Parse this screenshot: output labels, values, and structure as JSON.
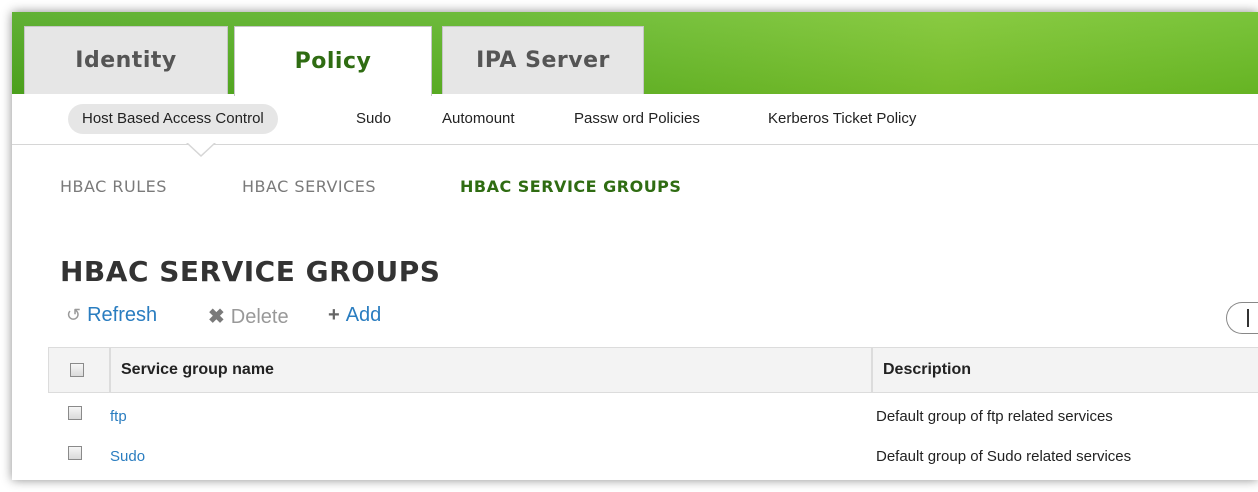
{
  "header": {
    "tabs": [
      {
        "label": "Identity"
      },
      {
        "label": "Policy"
      },
      {
        "label": "IPA Server"
      }
    ]
  },
  "subnav": {
    "items": [
      {
        "label": "Host Based Access Control"
      },
      {
        "label": "Sudo"
      },
      {
        "label": "Automount"
      },
      {
        "label": "Passw ord Policies"
      },
      {
        "label": "Kerberos Ticket Policy"
      }
    ]
  },
  "facets": [
    {
      "label": "HBAC RULES"
    },
    {
      "label": "HBAC SERVICES"
    },
    {
      "label": "HBAC SERVICE GROUPS"
    }
  ],
  "page": {
    "title": "HBAC SERVICE GROUPS"
  },
  "actions": {
    "refresh": "Refresh",
    "delete": "Delete",
    "add": "Add"
  },
  "table": {
    "columns": [
      "Service group name",
      "Description"
    ],
    "rows": [
      {
        "name": "ftp",
        "description": "Default group of ftp related services"
      },
      {
        "name": "Sudo",
        "description": "Default group of Sudo related services"
      }
    ]
  }
}
